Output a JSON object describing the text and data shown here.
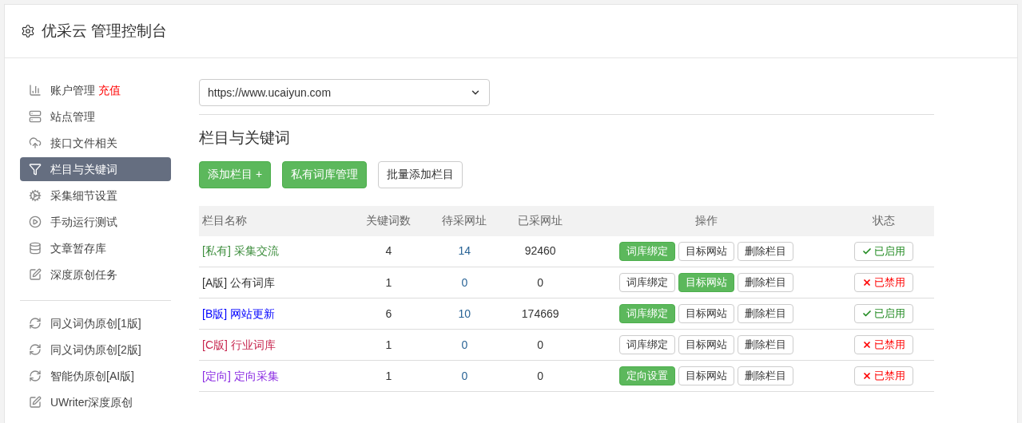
{
  "header": {
    "title": "优采云 管理控制台"
  },
  "sidebar": {
    "groups": [
      [
        {
          "label": "账户管理",
          "badge": "充值",
          "selected": false
        },
        {
          "label": "站点管理",
          "selected": false
        },
        {
          "label": "接口文件相关",
          "selected": false
        },
        {
          "label": "栏目与关键词",
          "selected": true
        },
        {
          "label": "采集细节设置",
          "selected": false
        },
        {
          "label": "手动运行测试",
          "selected": false
        },
        {
          "label": "文章暂存库",
          "selected": false
        },
        {
          "label": "深度原创任务",
          "selected": false
        }
      ],
      [
        {
          "label": "同义词伪原创[1版]",
          "selected": false
        },
        {
          "label": "同义词伪原创[2版]",
          "selected": false
        },
        {
          "label": "智能伪原创[AI版]",
          "selected": false
        },
        {
          "label": "UWriter深度原创",
          "selected": false
        }
      ]
    ]
  },
  "site_select": {
    "value": "https://www.ucaiyun.com"
  },
  "section_title": "栏目与关键词",
  "toolbar": [
    {
      "label": "添加栏目 +",
      "kind": "success"
    },
    {
      "label": "私有词库管理",
      "kind": "success"
    },
    {
      "label": "批量添加栏目",
      "kind": "default"
    }
  ],
  "table": {
    "columns": [
      "栏目名称",
      "关键词数",
      "待采网址",
      "已采网址",
      "操作",
      "状态"
    ],
    "rows": [
      {
        "tag": "[私有]",
        "name": "采集交流",
        "color": "#3c8d3c",
        "col2": "4",
        "col3": "14",
        "col4": "92460",
        "actions": [
          {
            "label": "词库绑定",
            "kind": "success"
          },
          {
            "label": "目标网站",
            "kind": "default"
          },
          {
            "label": "删除栏目",
            "kind": "default"
          }
        ],
        "status": "已启用",
        "on": true
      },
      {
        "tag": "[A版]",
        "name": "公有词库",
        "color": "#333333",
        "col2": "1",
        "col3": "0",
        "col4": "0",
        "actions": [
          {
            "label": "词库绑定",
            "kind": "default"
          },
          {
            "label": "目标网站",
            "kind": "success"
          },
          {
            "label": "删除栏目",
            "kind": "default"
          }
        ],
        "status": "已禁用",
        "on": false
      },
      {
        "tag": "[B版]",
        "name": "网站更新",
        "color": "#0000ff",
        "col2": "6",
        "col3": "10",
        "col4": "174669",
        "actions": [
          {
            "label": "词库绑定",
            "kind": "success"
          },
          {
            "label": "目标网站",
            "kind": "default"
          },
          {
            "label": "删除栏目",
            "kind": "default"
          }
        ],
        "status": "已启用",
        "on": true
      },
      {
        "tag": "[C版]",
        "name": "行业词库",
        "color": "#c7254e",
        "col2": "1",
        "col3": "0",
        "col4": "0",
        "actions": [
          {
            "label": "词库绑定",
            "kind": "default"
          },
          {
            "label": "目标网站",
            "kind": "default"
          },
          {
            "label": "删除栏目",
            "kind": "default"
          }
        ],
        "status": "已禁用",
        "on": false
      },
      {
        "tag": "[定向]",
        "name": "定向采集",
        "color": "#8a2be2",
        "col2": "1",
        "col3": "0",
        "col4": "0",
        "actions": [
          {
            "label": "定向设置",
            "kind": "success"
          },
          {
            "label": "目标网站",
            "kind": "default"
          },
          {
            "label": "删除栏目",
            "kind": "default"
          }
        ],
        "status": "已禁用",
        "on": false
      }
    ]
  }
}
